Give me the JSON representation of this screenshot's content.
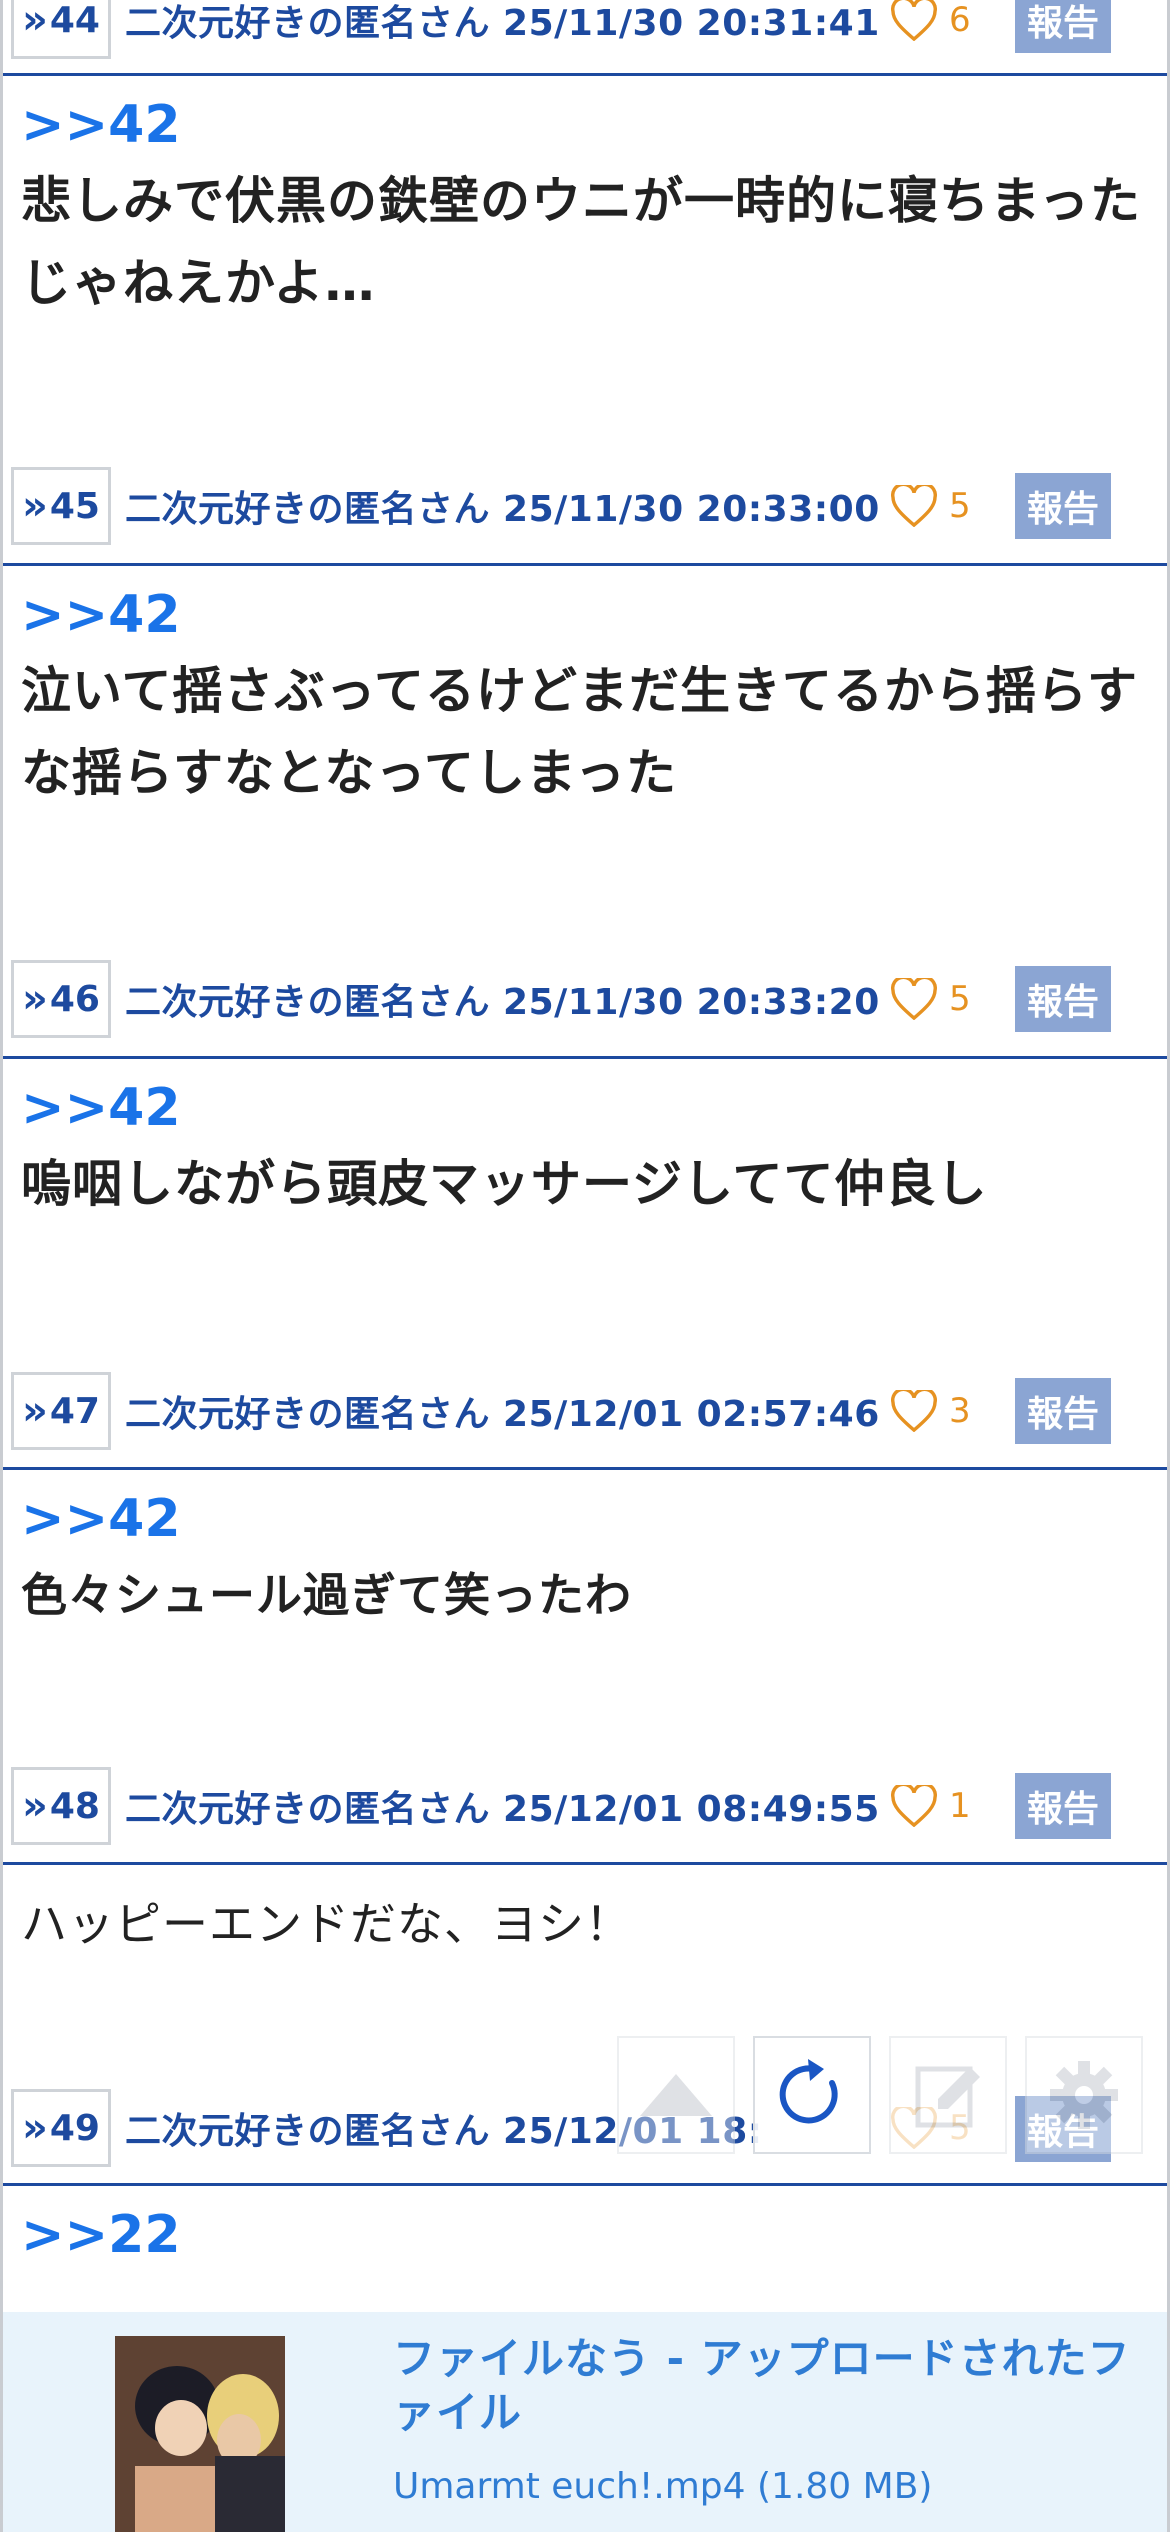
{
  "posts": [
    {
      "number": "44",
      "author_time": "二次元好きの匿名さん 25/11/30 20:31:41",
      "likes": "6",
      "report_label": "報告"
    },
    {
      "anchor": ">>42",
      "text": "悲しみで伏黒の鉄壁のウニが一時的に寝ちまったじゃねえかよ…",
      "number": "45",
      "author_time": "二次元好きの匿名さん 25/11/30 20:33:00",
      "likes": "5",
      "report_label": "報告"
    },
    {
      "anchor": ">>42",
      "text": "泣いて揺さぶってるけどまだ生きてるから揺らすな揺らすなとなってしまった",
      "number": "46",
      "author_time": "二次元好きの匿名さん 25/11/30 20:33:20",
      "likes": "5",
      "report_label": "報告"
    },
    {
      "anchor": ">>42",
      "text": "嗚咽しながら頭皮マッサージしてて仲良し",
      "number": "47",
      "author_time": "二次元好きの匿名さん 25/12/01 02:57:46",
      "likes": "3",
      "report_label": "報告"
    },
    {
      "anchor": ">>42",
      "text": "色々シュール過ぎて笑ったわ",
      "number": "48",
      "author_time": "二次元好きの匿名さん 25/12/01 08:49:55",
      "likes": "1",
      "report_label": "報告"
    },
    {
      "text": "ハッピーエンドだな、ヨシ！",
      "number": "49",
      "author_time": "二次元好きの匿名さん 25/12/01 18:",
      "likes": "5",
      "report_label": "報告"
    },
    {
      "anchor": ">>22"
    }
  ],
  "toolbar": {
    "scroll_top_icon": "triangle-up-icon",
    "reload_icon": "reload-icon",
    "write_icon": "pencil-icon",
    "settings_icon": "gear-icon"
  },
  "file_card": {
    "title": "ファイルなう - アップロードされたファイル",
    "file_info": "Umarmt euch!.mp4 (1.80 MB)"
  },
  "colors": {
    "accent_blue": "#1a73e8",
    "meta_blue": "#1d4a9f",
    "like_orange": "#e69221",
    "report_bg": "#8ba5d3",
    "file_card_bg": "#e8f3fb"
  }
}
